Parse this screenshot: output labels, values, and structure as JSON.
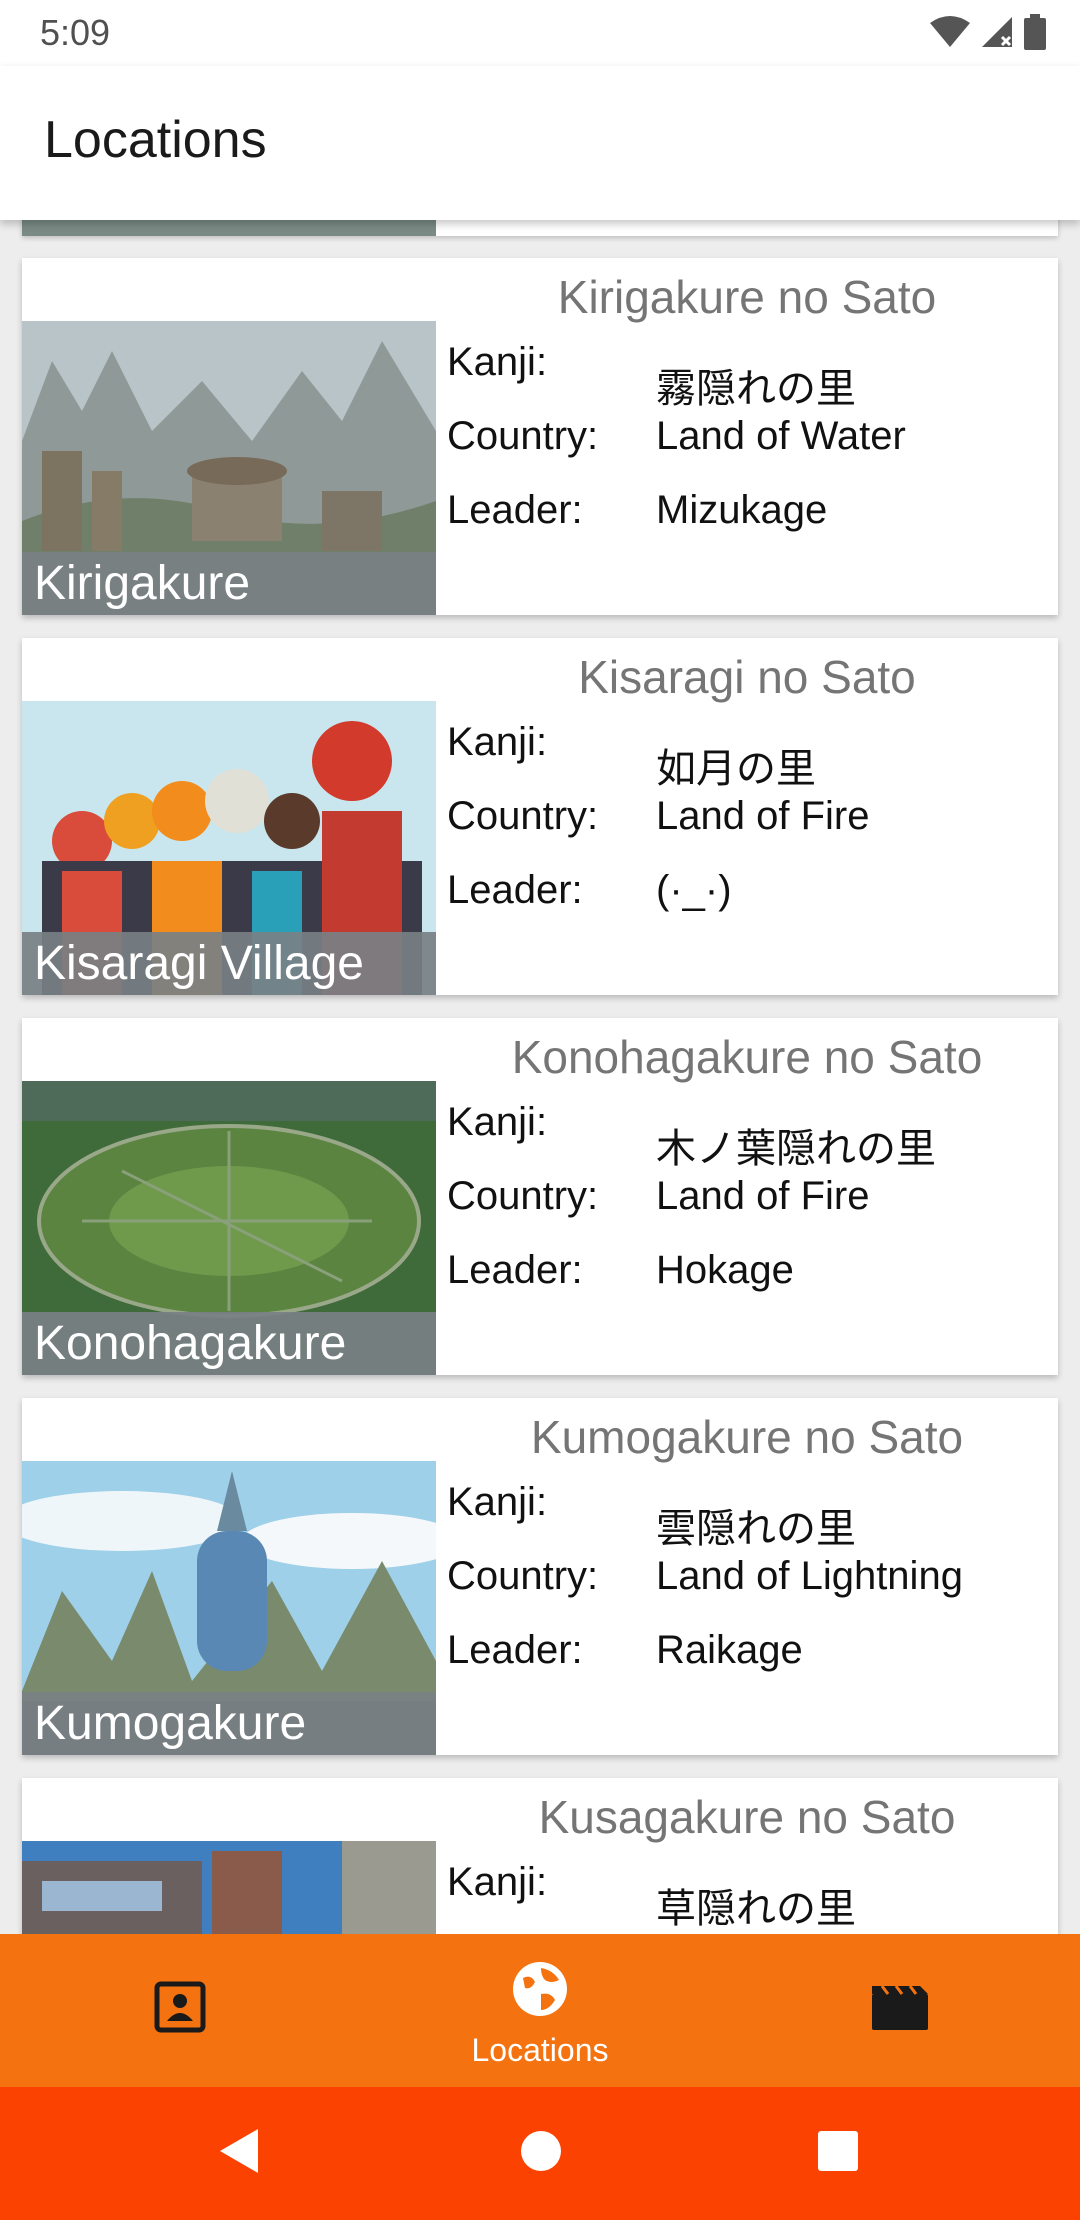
{
  "status_bar": {
    "time": "5:09"
  },
  "app_bar": {
    "title": "Locations"
  },
  "locations": [
    {
      "name": "Kirigakure no Sato",
      "caption": "Kirigakure",
      "kanji_label": "Kanji:",
      "kanji": "霧隠れの里",
      "country_label": "Country:",
      "country": "Land of Water",
      "leader_label": "Leader:",
      "leader": "Mizukage"
    },
    {
      "name": "Kisaragi no Sato",
      "caption": "Kisaragi Village",
      "kanji_label": "Kanji:",
      "kanji": "如月の里",
      "country_label": "Country:",
      "country": "Land of Fire",
      "leader_label": "Leader:",
      "leader": "(·_·)"
    },
    {
      "name": "Konohagakure no Sato",
      "caption": "Konohagakure",
      "kanji_label": "Kanji:",
      "kanji": "木ノ葉隠れの里",
      "country_label": "Country:",
      "country": "Land of Fire",
      "leader_label": "Leader:",
      "leader": "Hokage"
    },
    {
      "name": "Kumogakure no Sato",
      "caption": "Kumogakure",
      "kanji_label": "Kanji:",
      "kanji": "雲隠れの里",
      "country_label": "Country:",
      "country": "Land of Lightning",
      "leader_label": "Leader:",
      "leader": "Raikage"
    },
    {
      "name": "Kusagakure no Sato",
      "kanji_label": "Kanji:",
      "kanji": "草隠れの里"
    }
  ],
  "bottom_nav": {
    "items": [
      {
        "icon": "portrait-icon",
        "label": ""
      },
      {
        "icon": "globe-icon",
        "label": "Locations"
      },
      {
        "icon": "clapperboard-icon",
        "label": ""
      }
    ]
  },
  "colors": {
    "bottom_nav": "#f4720f",
    "system_nav": "#fb4200",
    "caption_bg": "#78808a"
  }
}
